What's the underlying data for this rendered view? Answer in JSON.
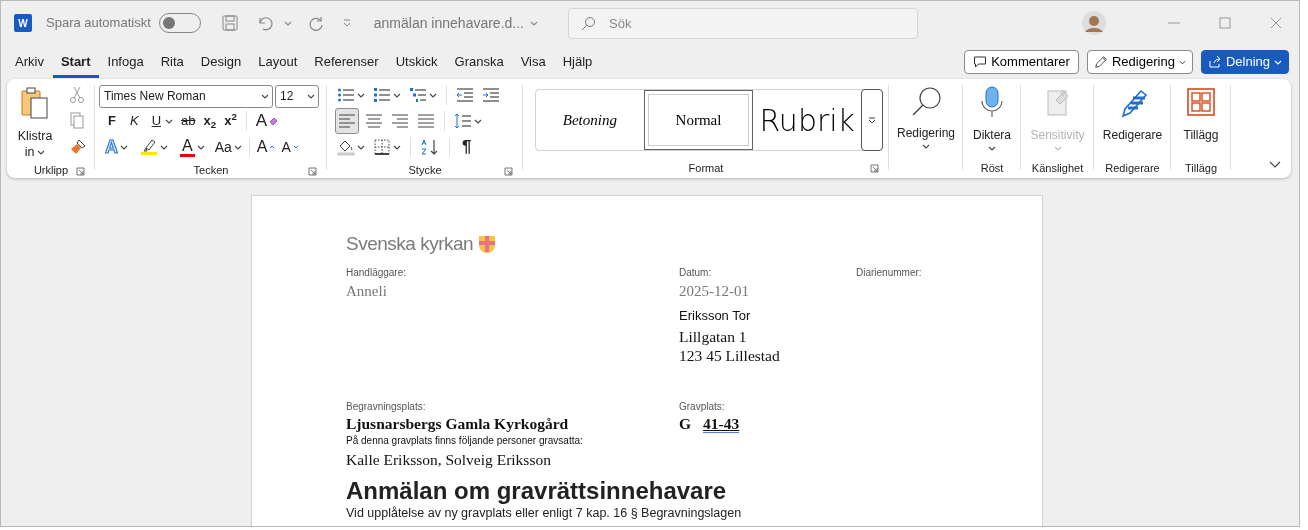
{
  "titlebar": {
    "app_letter": "W",
    "autosave": {
      "label": "Spara automatiskt",
      "on": false
    },
    "document_name": "anmälan innehavare.d...",
    "search": {
      "placeholder": "Sök"
    }
  },
  "tabs": [
    {
      "label": "Arkiv",
      "selected": false
    },
    {
      "label": "Start",
      "selected": true
    },
    {
      "label": "Infoga",
      "selected": false
    },
    {
      "label": "Rita",
      "selected": false
    },
    {
      "label": "Design",
      "selected": false
    },
    {
      "label": "Layout",
      "selected": false
    },
    {
      "label": "Referenser",
      "selected": false
    },
    {
      "label": "Utskick",
      "selected": false
    },
    {
      "label": "Granska",
      "selected": false
    },
    {
      "label": "Visa",
      "selected": false
    },
    {
      "label": "Hjälp",
      "selected": false
    }
  ],
  "header_buttons": {
    "comments": "Kommentarer",
    "editing": "Redigering",
    "share": "Delning"
  },
  "ribbon": {
    "clipboard": {
      "paste": "Klistra in",
      "label": "Urklipp"
    },
    "font": {
      "name": "Times New Roman",
      "size": "12",
      "bold": "F",
      "italic": "K",
      "underline": "U",
      "strike": "ab",
      "subscript": "x$_{2}$",
      "superscript": "x$^{2}$",
      "clear": "A",
      "effects": "A",
      "font_color": "A",
      "change_case": "Aa",
      "grow": "A",
      "shrink": "A",
      "label": "Tecken"
    },
    "paragraph": {
      "alignment": [
        {
          "selected": true
        },
        {
          "selected": false
        },
        {
          "selected": false
        },
        {
          "selected": false
        }
      ],
      "pilcrow": "¶",
      "label": "Stycke"
    },
    "styles": {
      "items": [
        {
          "label": "Betoning",
          "selected": false
        },
        {
          "label": "Normal",
          "selected": true
        },
        {
          "label": "Rubrik",
          "selected": false
        }
      ],
      "label": "Format"
    },
    "commands": [
      {
        "button": "Redigering",
        "disabled": false
      },
      {
        "button": "Diktera",
        "label": "Röst",
        "disabled": false
      },
      {
        "button": "Sensitivity",
        "label": "Känslighet",
        "disabled": true
      },
      {
        "button": "Redigerare",
        "label": "Redigerare",
        "disabled": false
      },
      {
        "button": "Tillägg",
        "label": "Tillägg",
        "disabled": false
      }
    ]
  },
  "document": {
    "logo": "Svenska kyrkan",
    "handler": {
      "label": "Handläggare:",
      "value": "Anneli"
    },
    "date": {
      "label": "Datum:",
      "value": "2025-12-01"
    },
    "reference": {
      "label": "Diarienummer:"
    },
    "recipient": [
      "Eriksson Tor",
      "Lillgatan 1",
      "123 45 Lillestad"
    ],
    "cemetery": {
      "label": "Begravningsplats:",
      "value": "Ljusnarsbergs Gamla Kyrkogård"
    },
    "grave": {
      "label": "Gravplats:",
      "block": "G",
      "number": "41-43"
    },
    "buried_note": "På denna gravplats finns följande personer gravsatta:",
    "buried": "Kalle Eriksson, Solveig Eriksson",
    "heading": "Anmälan om gravrättsinnehavare",
    "subheading": "Vid upplåtelse av ny gravplats eller enligt 7 kap. 16 § Begravningslagen"
  }
}
